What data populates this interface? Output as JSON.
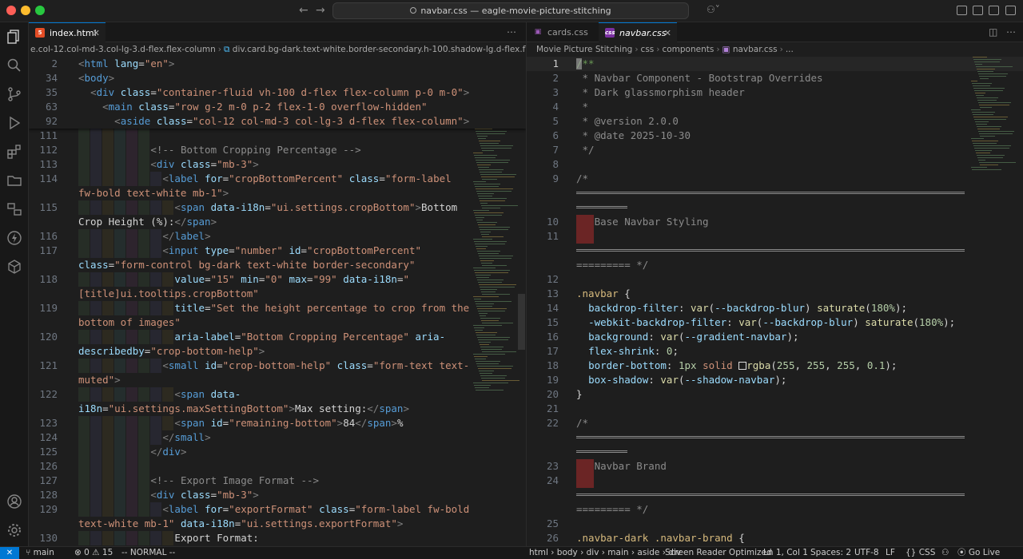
{
  "window": {
    "title": "navbar.css — eagle-movie-picture-stitching"
  },
  "activity": [
    "explorer-icon",
    "search-icon",
    "source-control-icon",
    "run-debug-icon",
    "extensions-icon",
    "folder-icon",
    "remote-explorer-icon",
    "lightning-icon",
    "packages-icon"
  ],
  "left": {
    "tab": {
      "label": "index.html"
    },
    "breadcrumb": [
      "e.col-12.col-md-3.col-lg-3.d-flex.flex-column",
      "div.card.bg-dark.text-white.border-secondary.h-100.shadow-lg.d-flex.flex-column"
    ],
    "sticky": [
      {
        "n": "2",
        "html": "<span class='p'>&lt;</span><span class='t'>html</span> <span class='a'>lang</span><span class='w'>=</span><span class='s'>\"en\"</span><span class='p'>&gt;</span>"
      },
      {
        "n": "34",
        "html": "<span class='p'>&lt;</span><span class='t'>body</span><span class='p'>&gt;</span>"
      },
      {
        "n": "35",
        "html": "  <span class='p'>&lt;</span><span class='t'>div</span> <span class='a'>class</span><span class='w'>=</span><span class='s'>\"container-fluid vh-100 d-flex flex-column p-0 m-0\"</span><span class='p'>&gt;</span>"
      },
      {
        "n": "63",
        "html": "    <span class='p'>&lt;</span><span class='t'>main</span> <span class='a'>class</span><span class='w'>=</span><span class='s'>\"row g-2 m-0 p-2 flex-1-0 overflow-hidden\"</span>"
      },
      {
        "n": "92",
        "html": "      <span class='p'>&lt;</span><span class='t'>aside</span> <span class='a'>class</span><span class='w'>=</span><span class='s'>\"col-12 col-md-3 col-lg-3 d-flex flex-column\"</span><span class='p'>&gt;</span>"
      }
    ],
    "lines": [
      {
        "n": "111",
        "g": 6,
        "html": ""
      },
      {
        "n": "112",
        "g": 6,
        "html": "            <span class='c'>&lt;!-- Bottom Cropping Percentage --&gt;</span>"
      },
      {
        "n": "113",
        "g": 6,
        "html": "            <span class='p'>&lt;</span><span class='t'>div</span> <span class='a'>class</span><span class='w'>=</span><span class='s'>\"mb-3\"</span><span class='p'>&gt;</span>"
      },
      {
        "n": "114",
        "g": 7,
        "html": "              <span class='p'>&lt;</span><span class='t'>label</span> <span class='a'>for</span><span class='w'>=</span><span class='s'>\"cropBottomPercent\"</span> <span class='a'>class</span><span class='w'>=</span><span class='s'>\"form-label</span>"
      },
      {
        "n": "",
        "g": 0,
        "html": "<span class='s'>fw-bold text-white mb-1\"</span><span class='p'>&gt;</span>"
      },
      {
        "n": "115",
        "g": 8,
        "html": "                <span class='p'>&lt;</span><span class='t'>span</span> <span class='a'>data-i18n</span><span class='w'>=</span><span class='s'>\"ui.settings.cropBottom\"</span><span class='p'>&gt;</span><span class='w'>Bottom</span>"
      },
      {
        "n": "",
        "g": 0,
        "html": "<span class='w'>Crop Height (%):</span><span class='p'>&lt;/</span><span class='t'>span</span><span class='p'>&gt;</span>"
      },
      {
        "n": "116",
        "g": 7,
        "html": "              <span class='p'>&lt;/</span><span class='t'>label</span><span class='p'>&gt;</span>"
      },
      {
        "n": "117",
        "g": 7,
        "html": "              <span class='p'>&lt;</span><span class='t'>input</span> <span class='a'>type</span><span class='w'>=</span><span class='s'>\"number\"</span> <span class='a'>id</span><span class='w'>=</span><span class='s'>\"cropBottomPercent\"</span>"
      },
      {
        "n": "",
        "g": 0,
        "html": "<span class='a'>class</span><span class='w'>=</span><span class='s'>\"form-control bg-dark text-white border-secondary\"</span>"
      },
      {
        "n": "118",
        "g": 8,
        "html": "                <span class='a'>value</span><span class='w'>=</span><span class='s'>\"15\"</span> <span class='a'>min</span><span class='w'>=</span><span class='s'>\"0\"</span> <span class='a'>max</span><span class='w'>=</span><span class='s'>\"99\"</span> <span class='a'>data-i18n</span><span class='w'>=</span><span class='s'>\"</span>"
      },
      {
        "n": "",
        "g": 0,
        "html": "<span class='s'>[title]ui.tooltips.cropBottom\"</span>"
      },
      {
        "n": "119",
        "g": 8,
        "html": "                <span class='a'>title</span><span class='w'>=</span><span class='s'>\"Set the height percentage to crop from the</span>"
      },
      {
        "n": "",
        "g": 0,
        "html": "<span class='s'>bottom of images\"</span>"
      },
      {
        "n": "120",
        "g": 8,
        "html": "                <span class='a'>aria-label</span><span class='w'>=</span><span class='s'>\"Bottom Cropping Percentage\"</span> <span class='a'>aria-</span>"
      },
      {
        "n": "",
        "g": 0,
        "html": "<span class='a'>describedby</span><span class='w'>=</span><span class='s'>\"crop-bottom-help\"</span><span class='p'>&gt;</span>"
      },
      {
        "n": "121",
        "g": 7,
        "html": "              <span class='p'>&lt;</span><span class='t'>small</span> <span class='a'>id</span><span class='w'>=</span><span class='s'>\"crop-bottom-help\"</span> <span class='a'>class</span><span class='w'>=</span><span class='s'>\"form-text text-</span>"
      },
      {
        "n": "",
        "g": 0,
        "html": "<span class='s'>muted\"</span><span class='p'>&gt;</span>"
      },
      {
        "n": "122",
        "g": 8,
        "html": "                <span class='p'>&lt;</span><span class='t'>span</span> <span class='a'>data-</span>"
      },
      {
        "n": "",
        "g": 0,
        "html": "<span class='a'>i18n</span><span class='w'>=</span><span class='s'>\"ui.settings.maxSettingBottom\"</span><span class='p'>&gt;</span><span class='w'>Max setting:</span><span class='p'>&lt;/</span><span class='t'>span</span><span class='p'>&gt;</span>"
      },
      {
        "n": "123",
        "g": 8,
        "html": "                <span class='p'>&lt;</span><span class='t'>span</span> <span class='a'>id</span><span class='w'>=</span><span class='s'>\"remaining-bottom\"</span><span class='p'>&gt;</span><span class='w'>84</span><span class='p'>&lt;/</span><span class='t'>span</span><span class='p'>&gt;</span><span class='w'>%</span>"
      },
      {
        "n": "124",
        "g": 7,
        "html": "              <span class='p'>&lt;/</span><span class='t'>small</span><span class='p'>&gt;</span>"
      },
      {
        "n": "125",
        "g": 6,
        "html": "            <span class='p'>&lt;/</span><span class='t'>div</span><span class='p'>&gt;</span>"
      },
      {
        "n": "126",
        "g": 6,
        "html": ""
      },
      {
        "n": "127",
        "g": 6,
        "html": "            <span class='c'>&lt;!-- Export Image Format --&gt;</span>"
      },
      {
        "n": "128",
        "g": 6,
        "html": "            <span class='p'>&lt;</span><span class='t'>div</span> <span class='a'>class</span><span class='w'>=</span><span class='s'>\"mb-3\"</span><span class='p'>&gt;</span>"
      },
      {
        "n": "129",
        "g": 7,
        "html": "              <span class='p'>&lt;</span><span class='t'>label</span> <span class='a'>for</span><span class='w'>=</span><span class='s'>\"exportFormat\"</span> <span class='a'>class</span><span class='w'>=</span><span class='s'>\"form-label fw-bold</span>"
      },
      {
        "n": "",
        "g": 0,
        "html": "<span class='s'>text-white mb-1\"</span> <span class='a'>data-i18n</span><span class='w'>=</span><span class='s'>\"ui.settings.exportFormat\"</span><span class='p'>&gt;</span>"
      },
      {
        "n": "130",
        "g": 8,
        "html": "                <span class='w'>Export Format:</span>"
      }
    ]
  },
  "right": {
    "tabs": [
      {
        "label": "cards.css"
      },
      {
        "label": "navbar.css"
      }
    ],
    "breadcrumb": [
      "Movie Picture Stitching",
      "css",
      "components",
      "navbar.css",
      "..."
    ],
    "lines": [
      {
        "n": "1",
        "cur": true,
        "html": "<span class='dcom'>/**</span>"
      },
      {
        "n": "2",
        "html": "<span class='c'> * Navbar Component - Bootstrap Overrides</span>"
      },
      {
        "n": "3",
        "html": "<span class='c'> * Dark glassmorphism header</span>"
      },
      {
        "n": "4",
        "html": "<span class='c'> *</span>"
      },
      {
        "n": "5",
        "html": "<span class='c'> * @version 2.0.0</span>"
      },
      {
        "n": "6",
        "html": "<span class='c'> * @date 2025-10-30</span>"
      },
      {
        "n": "7",
        "html": "<span class='c'> */</span>"
      },
      {
        "n": "8",
        "html": ""
      },
      {
        "n": "9",
        "html": "<span class='c'>/*</span>"
      },
      {
        "n": "",
        "rule": true,
        "html": ""
      },
      {
        "n": "",
        "rule": true,
        "short": true,
        "html": ""
      },
      {
        "n": "10",
        "red": true,
        "html": "<span class='c'>   Base Navbar Styling</span>"
      },
      {
        "n": "11",
        "red": true,
        "html": ""
      },
      {
        "n": "",
        "rule": true,
        "html": ""
      },
      {
        "n": "",
        "html": "<span class='c'>========= */</span>"
      },
      {
        "n": "12",
        "html": ""
      },
      {
        "n": "13",
        "html": "<span class='sel'>.navbar</span> <span class='w'>{</span>"
      },
      {
        "n": "14",
        "html": "  <span class='pr'>backdrop-filter</span><span class='w'>: </span><span class='fn'>var</span><span class='w'>(</span><span class='pr'>--backdrop-blur</span><span class='w'>) </span><span class='fn'>saturate</span><span class='w'>(</span><span class='nm'>180%</span><span class='w'>);</span>"
      },
      {
        "n": "15",
        "html": "  <span class='pr'>-webkit-backdrop-filter</span><span class='w'>: </span><span class='fn'>var</span><span class='w'>(</span><span class='pr'>--backdrop-blur</span><span class='w'>) </span><span class='fn'>saturate</span><span class='w'>(</span><span class='nm'>180%</span><span class='w'>);</span>"
      },
      {
        "n": "16",
        "html": "  <span class='pr'>background</span><span class='w'>: </span><span class='fn'>var</span><span class='w'>(</span><span class='pr'>--gradient-navbar</span><span class='w'>);</span>"
      },
      {
        "n": "17",
        "html": "  <span class='pr'>flex-shrink</span><span class='w'>: </span><span class='nm'>0</span><span class='w'>;</span>"
      },
      {
        "n": "18",
        "html": "  <span class='pr'>border-bottom</span><span class='w'>: </span><span class='nm'>1px</span> <span class='s'>solid</span> <span class='w' style='display:inline-block;width:10px;height:10px;border:1px solid #ddd;vertical-align:-1px;'></span><span class='fn'>rgba</span><span class='w'>(</span><span class='nm'>255</span><span class='w'>, </span><span class='nm'>255</span><span class='w'>, </span><span class='nm'>255</span><span class='w'>, </span><span class='nm'>0.1</span><span class='w'>);</span>"
      },
      {
        "n": "19",
        "html": "  <span class='pr'>box-shadow</span><span class='w'>: </span><span class='fn'>var</span><span class='w'>(</span><span class='pr'>--shadow-navbar</span><span class='w'>);</span>"
      },
      {
        "n": "20",
        "html": "<span class='w'>}</span>"
      },
      {
        "n": "21",
        "html": ""
      },
      {
        "n": "22",
        "html": "<span class='c'>/*</span>"
      },
      {
        "n": "",
        "rule": true,
        "html": ""
      },
      {
        "n": "",
        "rule": true,
        "short": true,
        "html": ""
      },
      {
        "n": "23",
        "red": true,
        "html": "<span class='c'>   Navbar Brand</span>"
      },
      {
        "n": "24",
        "red": true,
        "html": ""
      },
      {
        "n": "",
        "rule": true,
        "html": ""
      },
      {
        "n": "",
        "html": "<span class='c'>========= */</span>"
      },
      {
        "n": "25",
        "html": ""
      },
      {
        "n": "26",
        "html": "<span class='sel'>.navbar-dark .navbar-brand</span> <span class='w'>{</span>"
      }
    ]
  },
  "status": {
    "branch": "main",
    "problems": "⊗ 0 ⚠ 15",
    "mode": "-- NORMAL --",
    "breadcrumb": "html › body › div › main › aside › div",
    "screen_reader": "Screen Reader Optimized",
    "position": "Ln 1, Col 1",
    "spaces": "Spaces: 2",
    "encoding": "UTF-8",
    "eol": "LF",
    "language": "{} CSS",
    "golive": "Go Live"
  }
}
